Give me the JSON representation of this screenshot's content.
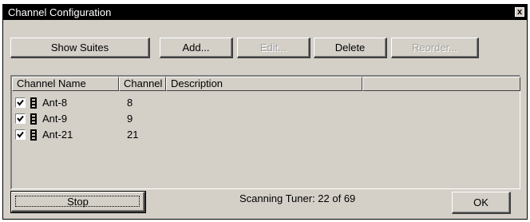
{
  "window": {
    "title": "Channel Configuration",
    "close_label": "x"
  },
  "toolbar": {
    "show_suites": "Show Suites",
    "add": "Add...",
    "edit": "Edit...",
    "delete": "Delete",
    "reorder": "Reorder..."
  },
  "list": {
    "columns": [
      "Channel Name",
      "Channel",
      "Description",
      ""
    ],
    "rows": [
      {
        "checked": true,
        "name": "Ant-8",
        "channel": "8",
        "description": ""
      },
      {
        "checked": true,
        "name": "Ant-9",
        "channel": "9",
        "description": ""
      },
      {
        "checked": true,
        "name": "Ant-21",
        "channel": "21",
        "description": ""
      }
    ]
  },
  "footer": {
    "stop": "Stop",
    "status": "Scanning Tuner:  22 of 69",
    "ok": "OK"
  }
}
